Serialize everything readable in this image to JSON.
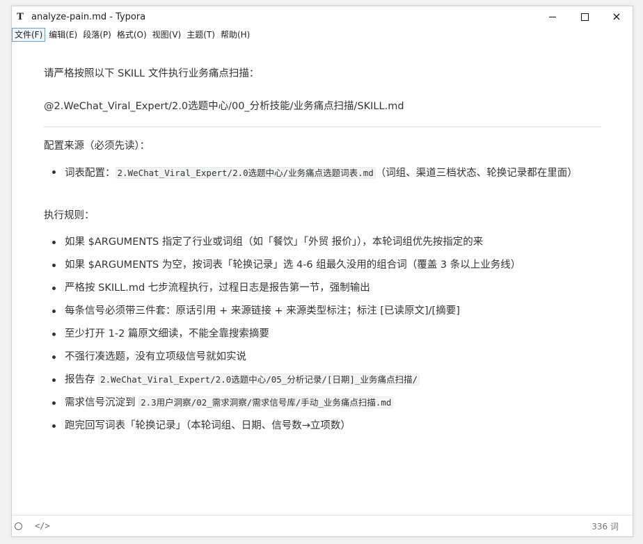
{
  "window": {
    "app_icon": "T",
    "title": "analyze-pain.md - Typora",
    "controls": {
      "minimize": "minimize-icon",
      "maximize": "maximize-icon",
      "close": "×"
    }
  },
  "menu": [
    "文件(F)",
    "编辑(E)",
    "段落(P)",
    "格式(O)",
    "视图(V)",
    "主题(T)",
    "帮助(H)"
  ],
  "doc": {
    "intro": "请严格按照以下 SKILL 文件执行业务痛点扫描：",
    "skill_path": "@2.WeChat_Viral_Expert/2.0选题中心/00_分析技能/业务痛点扫描/SKILL.md",
    "config_heading": "配置来源（必须先读）：",
    "config_item": {
      "label": "词表配置：",
      "code": "2.WeChat_Viral_Expert/2.0选题中心/业务痛点选题词表.md",
      "suffix": "（词组、渠道三档状态、轮换记录都在里面）"
    },
    "rules_heading": "执行规则：",
    "rules": [
      {
        "text": "如果 $ARGUMENTS 指定了行业或词组（如「餐饮」「外贸 报价」），本轮词组优先按指定的来"
      },
      {
        "text": "如果 $ARGUMENTS 为空，按词表「轮换记录」选 4-6 组最久没用的组合词（覆盖 3 条以上业务线）"
      },
      {
        "text": "严格按 SKILL.md 七步流程执行，过程日志是报告第一节，强制输出"
      },
      {
        "text": "每条信号必须带三件套：原话引用 + 来源链接 + 来源类型标注；标注 [已读原文]/[摘要]"
      },
      {
        "text": "至少打开 1-2 篇原文细读，不能全靠搜索摘要"
      },
      {
        "text": "不强行凑选题，没有立项级信号就如实说"
      },
      {
        "prefix": "报告存 ",
        "code": "2.WeChat_Viral_Expert/2.0选题中心/05_分析记录/[日期]_业务痛点扫描/"
      },
      {
        "prefix": "需求信号沉淀到 ",
        "code": "2.3用户洞察/02_需求洞察/需求信号库/手动_业务痛点扫描.md"
      },
      {
        "text": "跑完回写词表「轮换记录」（本轮词组、日期、信号数→立项数）"
      }
    ]
  },
  "status": {
    "outline_icon": "circle-icon",
    "source_icon": "</>",
    "word_count": "336 词"
  }
}
